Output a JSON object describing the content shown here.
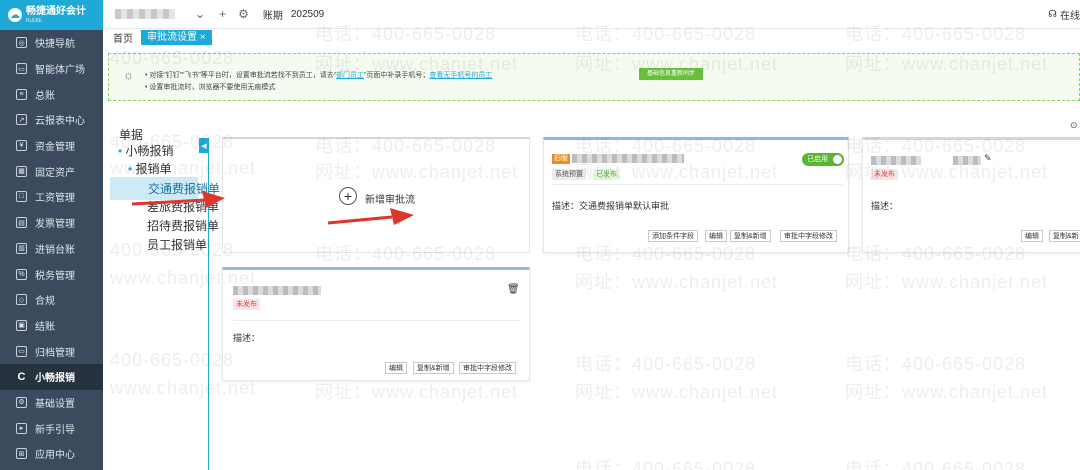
{
  "app": {
    "title": "畅捷通好会计",
    "subtitle": "RUIJIE"
  },
  "sidebar": {
    "items": [
      {
        "label": "快捷导航"
      },
      {
        "label": "智能体广场"
      },
      {
        "label": "总账"
      },
      {
        "label": "云报表中心"
      },
      {
        "label": "资金管理"
      },
      {
        "label": "固定资产"
      },
      {
        "label": "工资管理"
      },
      {
        "label": "发票管理"
      },
      {
        "label": "进销台账"
      },
      {
        "label": "税务管理"
      },
      {
        "label": "合规"
      },
      {
        "label": "结账"
      },
      {
        "label": "归档管理"
      },
      {
        "label": "小畅报销"
      },
      {
        "label": "基础设置"
      },
      {
        "label": "新手引导"
      },
      {
        "label": "应用中心"
      }
    ],
    "active_index": 13
  },
  "topbar": {
    "period_label": "账期",
    "period_value": "202509",
    "right_label": "在线"
  },
  "tabs": {
    "home": "首页",
    "active": "审批流设置"
  },
  "notice": {
    "line1_a": "• 对接“钉钉”“飞书”等平台时，设置审批流若找不到员工，请去“",
    "line1_link1": "部门员工",
    "line1_b": "”页面中补录手机号；",
    "line1_link2": "查看无手机号的员工",
    "line2": "• 设置审批流时，浏览器不要使用无痕模式",
    "sync_button": "基础信息重新同步"
  },
  "tree": {
    "root": "单据",
    "l1": "小畅报销",
    "l2": "报销单",
    "leaves": [
      "交通费报销单",
      "差旅费报销单",
      "招待费报销单",
      "员工报销单"
    ],
    "selected_index": 0
  },
  "add_flow": {
    "label": "新增审批流"
  },
  "card1": {
    "tag": "旧版",
    "toggle": "已启用",
    "badge1": "系统预置",
    "badge2": "已发布",
    "desc_label": "描述：",
    "desc_value": "交通费报销单默认审批",
    "buttons": [
      "添加条件字段",
      "编辑",
      "复制&新增",
      "审批中字段修改"
    ]
  },
  "card2": {
    "badge": "未发布",
    "desc_label": "描述：",
    "buttons": [
      "编辑",
      "复制&新"
    ]
  },
  "card3": {
    "badge": "未发布",
    "desc_label": "描述：",
    "buttons": [
      "编辑",
      "复制&新增",
      "审批中字段修改"
    ]
  },
  "watermark": {
    "phone": "电话：400-665-0028",
    "site": "网址：www.chanjet.net",
    "phone_short": "400-665-0028",
    "site_short": "www.chanjet.net"
  }
}
